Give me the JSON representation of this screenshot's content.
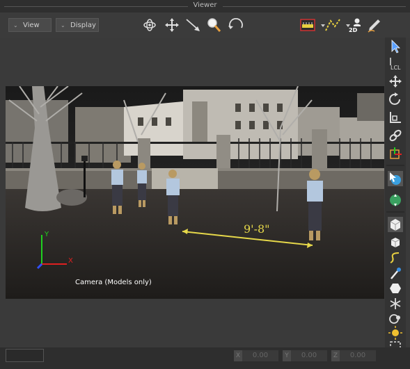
{
  "window": {
    "title": "Viewer"
  },
  "menus": {
    "view_label": "View",
    "display_label": "Display"
  },
  "viewport": {
    "camera_label": "Camera (Models only)",
    "measurement": "9'-8\""
  },
  "axes": {
    "x": "X",
    "y": "Y",
    "z": "Z"
  },
  "status": {
    "coords": [
      {
        "axis": "X",
        "value": "0.00"
      },
      {
        "axis": "Y",
        "value": "0.00"
      },
      {
        "axis": "Z",
        "value": "0.00"
      }
    ]
  },
  "colors": {
    "measure": "#e6d84a",
    "axis_x": "#e02020",
    "axis_y": "#20d020",
    "axis_z": "#3050ff"
  }
}
